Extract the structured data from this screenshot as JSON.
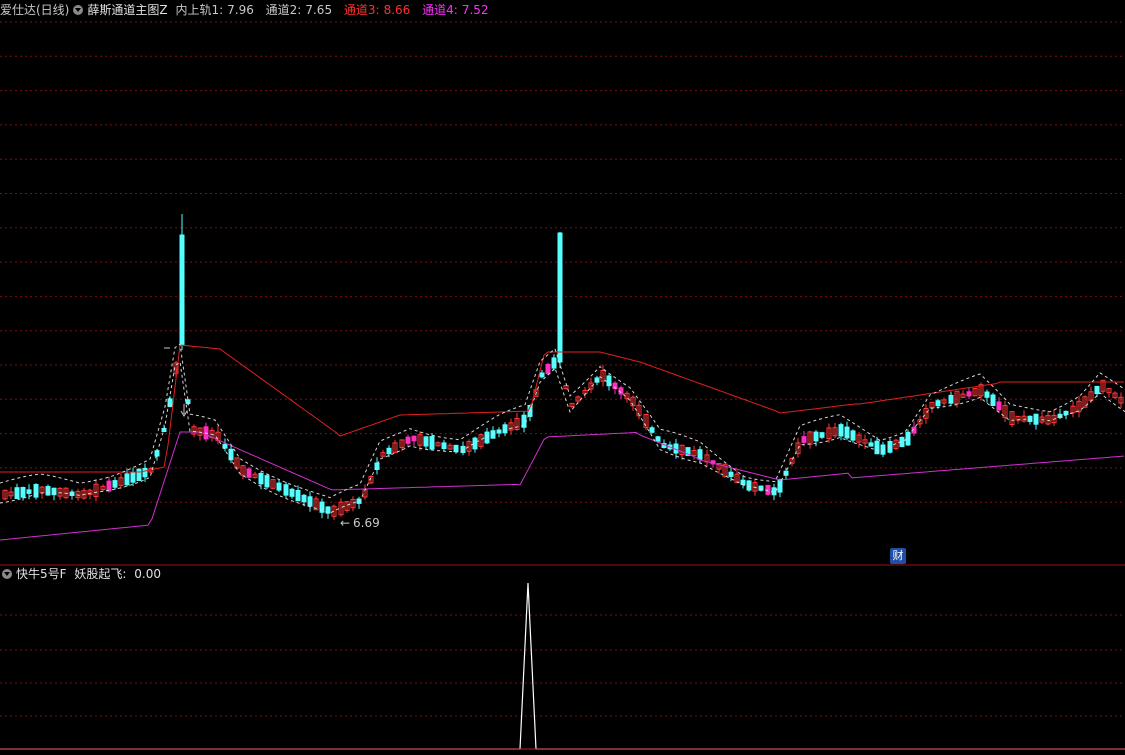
{
  "main_panel": {
    "app_name": "爱仕达(日线)",
    "indicator_name": "薛斯通道主图Z",
    "readouts": [
      {
        "label": "内上轨1:",
        "value": "7.96",
        "color": "#c8c8c8"
      },
      {
        "label": "通道2:",
        "value": "7.65",
        "color": "#c8c8c8"
      },
      {
        "label": "通道3:",
        "value": "8.66",
        "color": "#ff3030"
      },
      {
        "label": "通道4:",
        "value": "7.52",
        "color": "#ff30ff"
      }
    ],
    "low_marker": "6.69",
    "finance_badge": "财"
  },
  "sub_panel": {
    "indicator_name": "快牛5号F",
    "readout_label": "妖股起飞:",
    "readout_value": "0.00"
  },
  "colors": {
    "up": "#ff3838",
    "down": "#54ffff",
    "strong_up": "#ff30c0",
    "channel_upper": "#e02020",
    "channel_lower": "#d030d0",
    "inner_dashed": "#d8d8d8",
    "grid": "#7a1010",
    "signal": "#ffffff"
  }
}
